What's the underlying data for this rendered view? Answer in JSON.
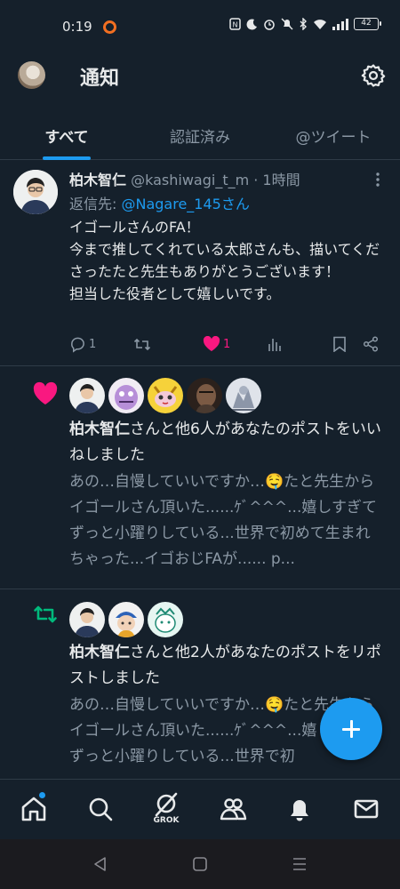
{
  "status_bar": {
    "time": "0:19",
    "battery": "42"
  },
  "header": {
    "title": "通知"
  },
  "tabs": [
    {
      "label": "すべて",
      "active": true
    },
    {
      "label": "認証済み",
      "active": false
    },
    {
      "label": "@ツイート",
      "active": false
    }
  ],
  "tweet": {
    "author_name": "柏木智仁",
    "author_handle": "@kashiwagi_t_m",
    "time": " · 1時間",
    "reply_prefix": "返信先: ",
    "reply_to": "@Nagare_145さん",
    "body": "イゴールさんのFA！\n今まで推してくれている太郎さんも、描いてくださったたと先生もありがとうございます！\n担当した役者として嬉しいです。",
    "replies": "1",
    "likes": "1",
    "liked": true
  },
  "notifications": [
    {
      "kind": "like",
      "icon": "heart-icon",
      "actor": "柏木智仁",
      "text": "さんと他6人があなたのポストをいいねしました",
      "quote": "あの…自慢していいですか…🤤たと先生からイゴールさん頂いた......ｹﾞ^^^...嬉しすぎてずっと小躍りしている...世界で初めて生まれちゃった...イゴおじFAが...... p..."
    },
    {
      "kind": "repost",
      "icon": "repost-icon",
      "actor": "柏木智仁",
      "text": "さんと他2人があなたのポストをリポストしました",
      "quote": "あの…自慢していいですか…🤤たと先生からイゴールさん頂いた......ｹﾞ^^^...嬉しすぎてずっと小躍りしている...世界で初"
    }
  ],
  "bottom_nav": {
    "items": [
      "home-icon",
      "search-icon",
      "grok-icon",
      "communities-icon",
      "notifications-icon",
      "messages-icon"
    ],
    "grok_label": "GROK"
  },
  "colors": {
    "accent": "#1d9bf0",
    "like": "#f91880",
    "repost": "#00ba7c",
    "background": "#15202b"
  }
}
